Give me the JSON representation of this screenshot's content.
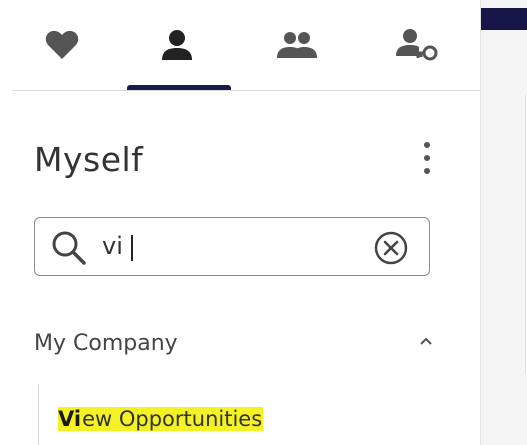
{
  "tabs": [
    {
      "id": "favorites",
      "icon": "heart-icon",
      "active": false
    },
    {
      "id": "myself",
      "icon": "person-icon",
      "active": true
    },
    {
      "id": "team",
      "icon": "people-icon",
      "active": false
    },
    {
      "id": "access",
      "icon": "person-key-icon",
      "active": false
    }
  ],
  "header": {
    "title": "Myself"
  },
  "search": {
    "value": "vi",
    "placeholder": ""
  },
  "section": {
    "label": "My Company",
    "expanded": true
  },
  "results": [
    {
      "match": "Vi",
      "rest": "ew Opportunities"
    }
  ],
  "colors": {
    "accent": "#1b1b4b",
    "highlight": "#f4f225",
    "icon": "#555555"
  }
}
